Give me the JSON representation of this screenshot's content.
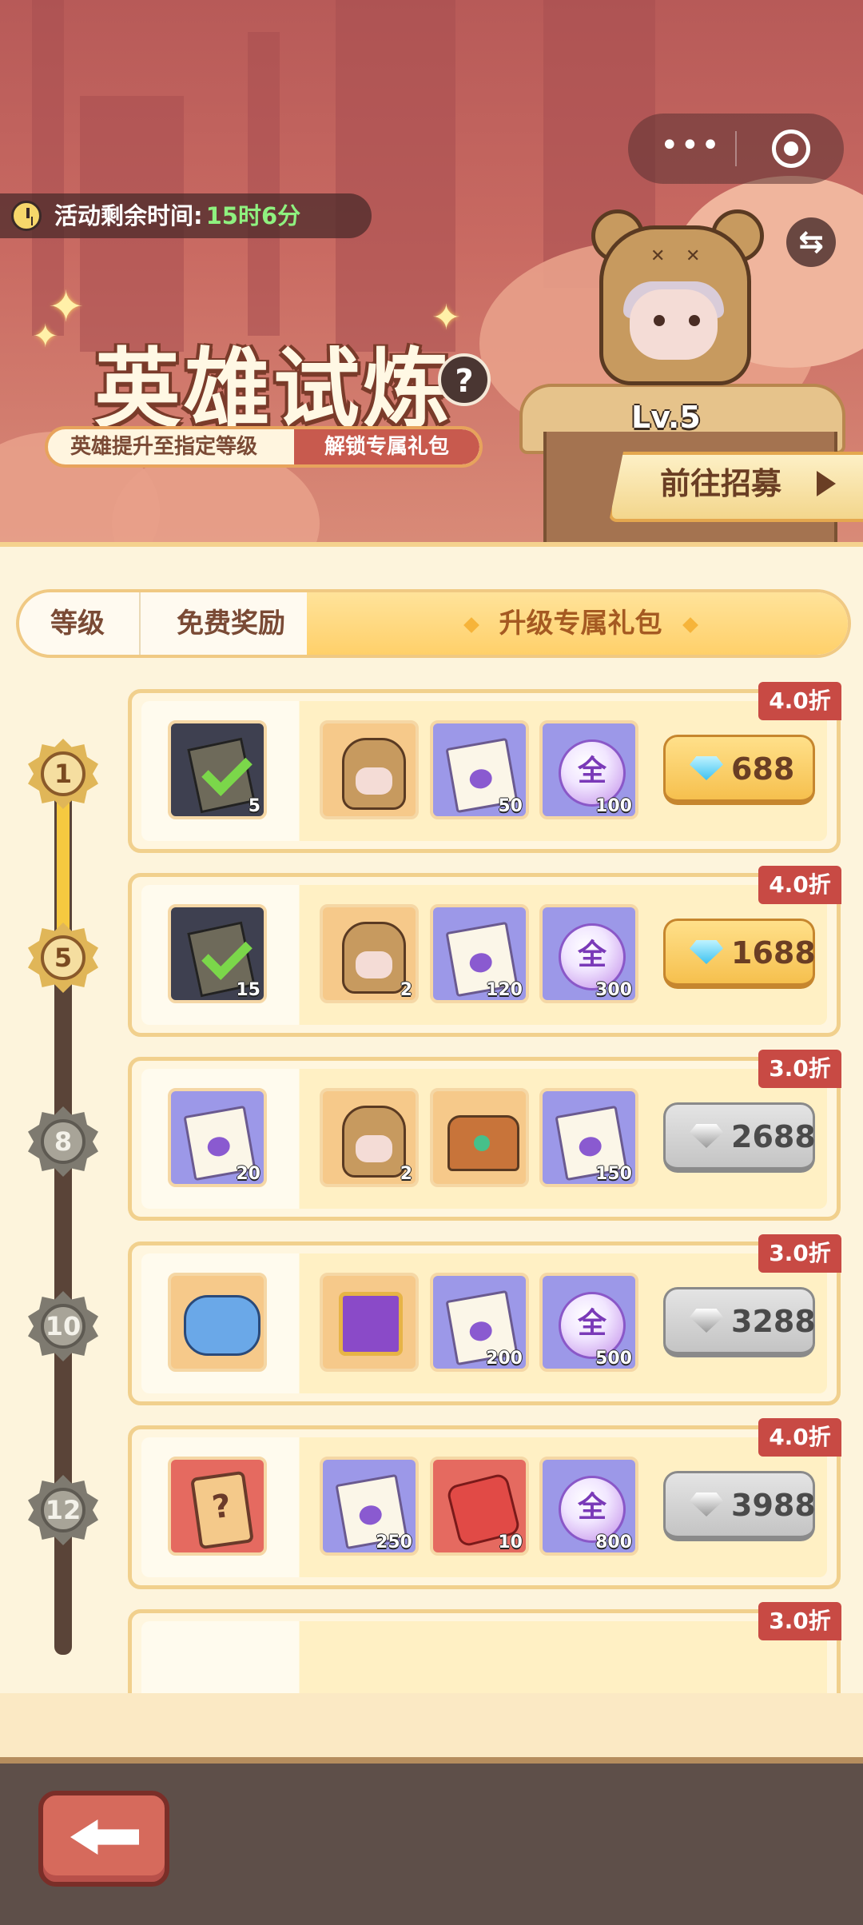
{
  "header": {
    "timer_label": "活动剩余时间:",
    "timer_value": "15时6分",
    "title": "英雄试炼",
    "subtitle_left": "英雄提升至指定等级",
    "subtitle_right": "解锁专属礼包",
    "hero_level": "Lv.5",
    "recruit_label": "前往招募",
    "help_glyph": "?",
    "swap_glyph": "⇆"
  },
  "tabs": {
    "level": "等级",
    "free": "免费奖励",
    "pack": "升级专属礼包"
  },
  "rows": [
    {
      "level": "1",
      "discount": "4.0折",
      "price": "688",
      "price_style": "gold",
      "first": {
        "icon": "notebook-check",
        "count": "5"
      },
      "items": [
        {
          "icon": "bear-hero",
          "count": ""
        },
        {
          "icon": "integral-scroll",
          "count": "50"
        },
        {
          "icon": "all-orb",
          "count": "100",
          "glyph": "全"
        }
      ]
    },
    {
      "level": "5",
      "discount": "4.0折",
      "price": "1688",
      "price_style": "gold",
      "first": {
        "icon": "notebook-check",
        "count": "15"
      },
      "items": [
        {
          "icon": "bear-hero",
          "count": "2"
        },
        {
          "icon": "integral-scroll",
          "count": "120"
        },
        {
          "icon": "all-orb",
          "count": "300",
          "glyph": "全"
        }
      ]
    },
    {
      "level": "8",
      "discount": "3.0折",
      "price": "2688",
      "price_style": "grey",
      "first": {
        "icon": "integral-scroll",
        "count": "20"
      },
      "items": [
        {
          "icon": "bear-hero",
          "count": "2"
        },
        {
          "icon": "treasure-chest",
          "count": ""
        },
        {
          "icon": "integral-scroll",
          "count": "150"
        }
      ]
    },
    {
      "level": "10",
      "discount": "3.0折",
      "price": "3288",
      "price_style": "grey",
      "first": {
        "icon": "hero-group",
        "count": ""
      },
      "items": [
        {
          "icon": "purple-box",
          "count": ""
        },
        {
          "icon": "integral-scroll",
          "count": "200"
        },
        {
          "icon": "all-orb",
          "count": "500",
          "glyph": "全"
        }
      ]
    },
    {
      "level": "12",
      "discount": "4.0折",
      "price": "3988",
      "price_style": "grey",
      "first": {
        "icon": "mystery-card",
        "count": "",
        "glyph": "?"
      },
      "items": [
        {
          "icon": "integral-scroll",
          "count": "250"
        },
        {
          "icon": "puzzle-piece",
          "count": "10"
        },
        {
          "icon": "all-orb",
          "count": "800",
          "glyph": "全"
        }
      ]
    },
    {
      "level": "",
      "discount": "3.0折",
      "price": "",
      "price_style": "grey",
      "first": null,
      "items": []
    }
  ],
  "colors": {
    "accent": "#f6c04e",
    "discount_tag": "#c84a44",
    "timer_value": "#8ff17f"
  }
}
